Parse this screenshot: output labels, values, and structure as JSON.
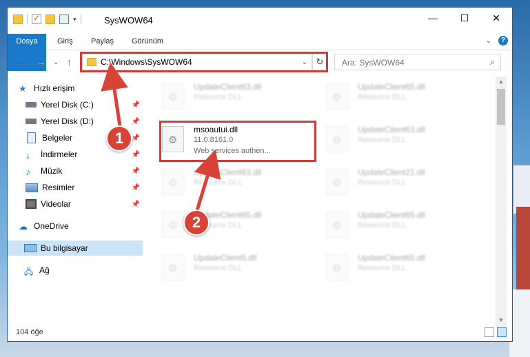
{
  "window": {
    "title": "SysWOW64",
    "controls": {
      "minimize": "—",
      "maximize": "☐",
      "close": "✕"
    }
  },
  "ribbon": {
    "tabs": [
      "Dosya",
      "Giriş",
      "Paylaş",
      "Görünüm"
    ],
    "expand": "⌄",
    "help": "?"
  },
  "navigation": {
    "back": "←",
    "forward": "→",
    "recent": "⌄",
    "up": "↑",
    "address": "C:\\Windows\\SysWOW64",
    "address_dropdown": "⌄",
    "refresh": "↻",
    "search_placeholder": "Ara: SysWOW64",
    "search_icon": "⌕"
  },
  "sidebar": {
    "quick_access": "Hızlı erişim",
    "items": [
      {
        "label": "Yerel Disk (C:)",
        "icon": "drive-icon",
        "pinned": true
      },
      {
        "label": "Yerel Disk (D:)",
        "icon": "drive-icon",
        "pinned": true
      },
      {
        "label": "Belgeler",
        "icon": "documents-icon",
        "pinned": true
      },
      {
        "label": "İndirmeler",
        "icon": "downloads-icon",
        "pinned": true
      },
      {
        "label": "Müzik",
        "icon": "music-icon",
        "pinned": true
      },
      {
        "label": "Resimler",
        "icon": "pictures-icon",
        "pinned": true
      },
      {
        "label": "Videolar",
        "icon": "videos-icon",
        "pinned": true
      }
    ],
    "onedrive": "OneDrive",
    "this_pc": "Bu bilgisayar",
    "network": "Ağ",
    "pin_glyph": "📌"
  },
  "files": [
    {
      "name": "UpdateClient63.dll",
      "line2": "Resource DLL",
      "line3": "",
      "highlighted": false
    },
    {
      "name": "UpdateClient65.dll",
      "line2": "Resource DLL",
      "line3": "",
      "highlighted": false
    },
    {
      "name": "msoautui.dll",
      "line2": "11.0.8161.0",
      "line3": "Web services authen...",
      "highlighted": true
    },
    {
      "name": "UpdateClient63.dll",
      "line2": "Resource DLL",
      "line3": "",
      "highlighted": false
    },
    {
      "name": "UpdateClient63.dll",
      "line2": "Resource DLL",
      "line3": "",
      "highlighted": false
    },
    {
      "name": "UpdateClient21.dll",
      "line2": "Resource DLL",
      "line3": "",
      "highlighted": false
    },
    {
      "name": "UpdateClient65.dll",
      "line2": "Resource DLL",
      "line3": "",
      "highlighted": false
    },
    {
      "name": "UpdateClient65.dll",
      "line2": "Resource DLL",
      "line3": "",
      "highlighted": false
    },
    {
      "name": "UpdateClient5.dll",
      "line2": "Resource DLL",
      "line3": "",
      "highlighted": false
    },
    {
      "name": "UpdateClient65.dll",
      "line2": "Resource DLL",
      "line3": "",
      "highlighted": false
    }
  ],
  "status": {
    "count": "104 öğe"
  },
  "annotations": {
    "step1": "1",
    "step2": "2",
    "color": "#d64437"
  }
}
